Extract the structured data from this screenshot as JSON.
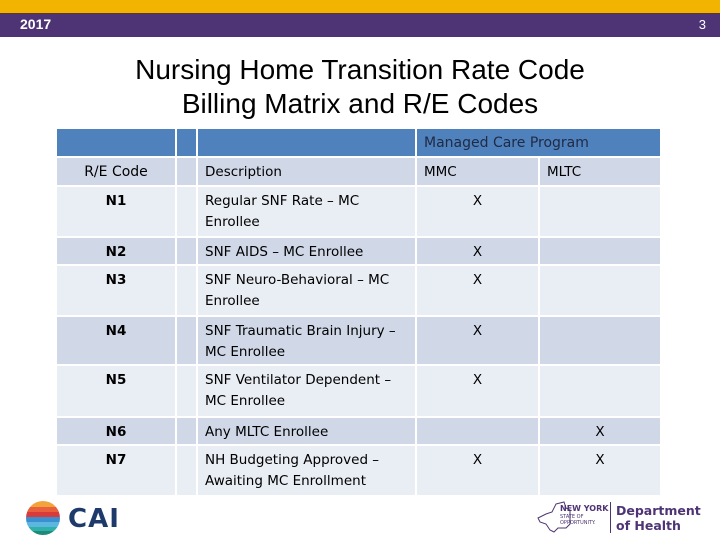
{
  "header": {
    "year": "2017",
    "page_number": "3"
  },
  "title": {
    "line1": "Nursing Home Transition Rate Code",
    "line2": "Billing Matrix and R/E Codes"
  },
  "table": {
    "group_header": "Managed Care Program",
    "columns": {
      "code": "R/E Code",
      "description": "Description",
      "mmc": "MMC",
      "mltc": "MLTC"
    },
    "rows": [
      {
        "code": "N1",
        "description": "Regular SNF Rate – MC Enrollee",
        "mmc": "X",
        "mltc": ""
      },
      {
        "code": "N2",
        "description": "SNF AIDS – MC Enrollee",
        "mmc": "X",
        "mltc": ""
      },
      {
        "code": "N3",
        "description": "SNF Neuro-Behavioral – MC Enrollee",
        "mmc": "X",
        "mltc": ""
      },
      {
        "code": "N4",
        "description": "SNF Traumatic Brain Injury – MC Enrollee",
        "mmc": "X",
        "mltc": ""
      },
      {
        "code": "N5",
        "description": "SNF Ventilator Dependent – MC Enrollee",
        "mmc": "X",
        "mltc": ""
      },
      {
        "code": "N6",
        "description": "Any MLTC Enrollee",
        "mmc": "",
        "mltc": "X"
      },
      {
        "code": "N7",
        "description": "NH Budgeting Approved – Awaiting MC Enrollment",
        "mmc": "X",
        "mltc": "X"
      }
    ]
  },
  "footer": {
    "left_logo": "CAI",
    "right_logo": {
      "state": "NEW YORK",
      "tagline1": "STATE OF",
      "tagline2": "OPPORTUNITY.",
      "dept_line1": "Department",
      "dept_line2": "of Health"
    }
  },
  "colors": {
    "gold": "#f2b400",
    "purple": "#4e3475",
    "header_blue": "#4f81bd",
    "row_dark": "#d0d8e8",
    "row_light": "#e9edf4"
  }
}
